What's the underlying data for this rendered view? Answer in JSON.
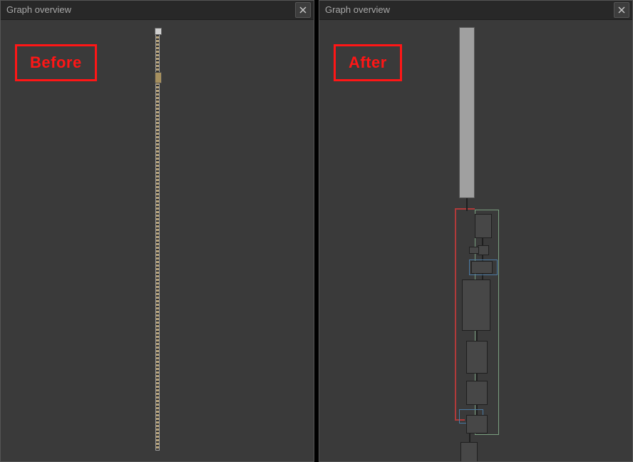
{
  "left_panel": {
    "title": "Graph overview",
    "badge": "Before"
  },
  "right_panel": {
    "title": "Graph overview",
    "badge": "After"
  }
}
